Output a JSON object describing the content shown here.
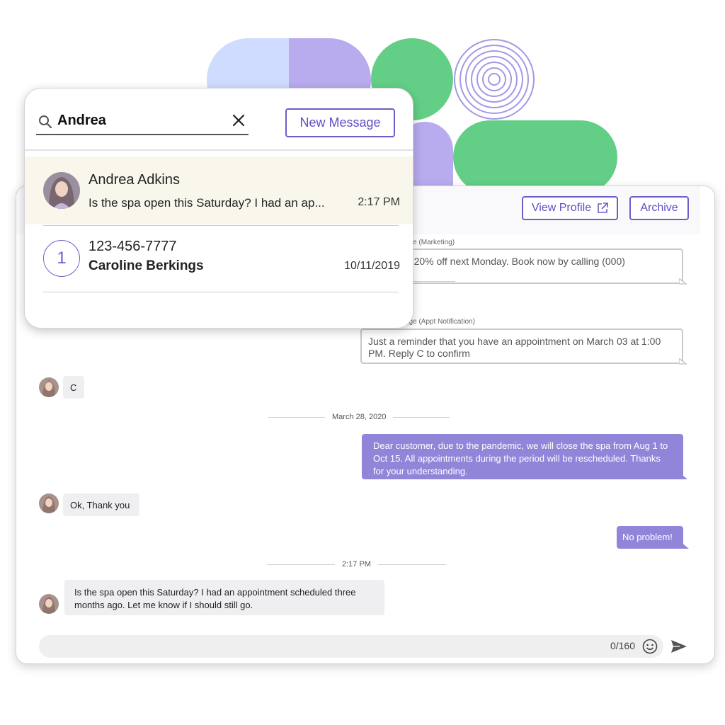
{
  "search_panel": {
    "query": "Andrea",
    "new_message_label": "New Message",
    "results": [
      {
        "name": "Andrea Adkins",
        "preview": "Is the spa open this Saturday? I had an ap...",
        "time": "2:17 PM"
      },
      {
        "badge": "1",
        "phone": "123-456-7777",
        "name": "Caroline Berkings",
        "time": "10/11/2019"
      }
    ]
  },
  "chat": {
    "header": {
      "view_profile_label": "View Profile",
      "archive_label": "Archive"
    },
    "system_messages": [
      {
        "label": "sage (Marketing)",
        "text": "elf! 20% off next Monday. Book now by calling (000)"
      },
      {
        "label": "sage (Appt Notification)",
        "text": "Just a reminder that you have an appointment on March 03 at 1:00 PM. Reply C to confirm"
      }
    ],
    "messages": [
      {
        "direction": "in",
        "text": "C"
      },
      {
        "divider": "March 28, 2020"
      },
      {
        "direction": "out",
        "text": "Dear customer, due to the pandemic, we will close the spa from Aug 1 to Oct 15. All appointments during the period will be rescheduled. Thanks for your understanding."
      },
      {
        "direction": "in",
        "text": "Ok, Thank you"
      },
      {
        "direction": "out",
        "text": "No problem!"
      },
      {
        "divider": "2:17 PM"
      },
      {
        "direction": "in",
        "text": "Is the spa open this Saturday? I had an appointment scheduled three months ago. Let me know if I should still go."
      }
    ],
    "composer": {
      "counter": "0/160"
    }
  },
  "colors": {
    "accent": "#6a5fc6",
    "outgoing_bubble": "#9085d8",
    "incoming_bubble": "#efeff1",
    "highlight_row": "#f9f7eb",
    "deco_blue": "#cfdcff",
    "deco_purple": "#b8abee",
    "deco_green": "#63cf86"
  },
  "icons": [
    "search-icon",
    "close-icon",
    "external-link-icon",
    "emoji-icon",
    "send-icon",
    "avatar"
  ]
}
